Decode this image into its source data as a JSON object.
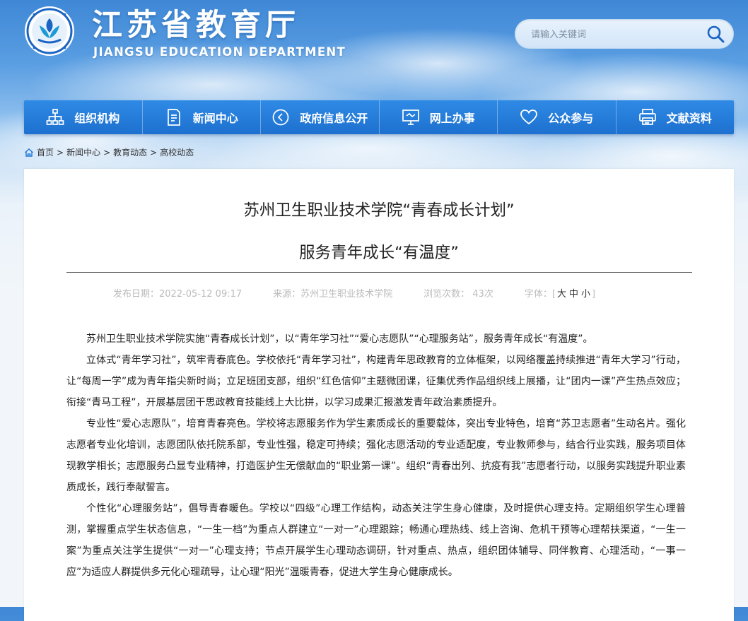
{
  "header": {
    "title": "江苏省教育厅",
    "subtitle": "JIANGSU EDUCATION DEPARTMENT",
    "search_placeholder": "请输入关键词"
  },
  "nav": [
    {
      "label": "组织机构",
      "icon": "org-chart-icon"
    },
    {
      "label": "新闻中心",
      "icon": "document-icon"
    },
    {
      "label": "政府信息公开",
      "icon": "disclosure-icon"
    },
    {
      "label": "网上办事",
      "icon": "monitor-icon"
    },
    {
      "label": "公众参与",
      "icon": "heart-icon"
    },
    {
      "label": "文献资料",
      "icon": "printer-icon"
    }
  ],
  "breadcrumb": [
    "首页",
    "新闻中心",
    "教育动态",
    "高校动态"
  ],
  "article": {
    "title_line1": "苏州卫生职业技术学院“青春成长计划”",
    "title_line2": "服务青年成长“有温度”",
    "meta": {
      "date": "发布日期：2022-05-12 09:17",
      "source": "来源：苏州卫生职业技术学院",
      "views": "浏览次数：  43次",
      "font_label": "字体：",
      "font_large": "大",
      "font_medium": "中",
      "font_small": "小"
    },
    "paragraphs": [
      "苏州卫生职业技术学院实施“青春成长计划”，以“青年学习社”“爱心志愿队”“心理服务站”，服务青年成长“有温度”。",
      "立体式“青年学习社”，筑牢青春底色。学校依托“青年学习社”，构建青年思政教育的立体框架，以网络覆盖持续推进“青年大学习”行动，让“每周一学”成为青年指尖新时尚；立足班团支部，组织“红色信仰”主题微团课，征集优秀作品组织线上展播，让“团内一课”产生热点效应；衔接“青马工程”，开展基层团干思政教育技能线上大比拼，以学习成果汇报激发青年政治素质提升。",
      "专业性“爱心志愿队”，培育青春亮色。学校将志愿服务作为学生素质成长的重要载体，突出专业特色，培育“苏卫志愿者”生动名片。强化志愿者专业化培训，志愿团队依托院系部，专业性强，稳定可持续；强化志愿活动的专业适配度，专业教师参与，结合行业实践，服务项目体现教学相长；志愿服务凸显专业精神，打造医护生无偿献血的“职业第一课”。组织“青春出列、抗疫有我”志愿者行动，以服务实践提升职业素质成长，践行奉献誓言。",
      "个性化“心理服务站”，倡导青春暖色。学校以“四级”心理工作结构，动态关注学生身心健康，及时提供心理支持。定期组织学生心理普测，掌握重点学生状态信息，“一生一档”为重点人群建立“一对一”心理跟踪；畅通心理热线、线上咨询、危机干预等心理帮扶渠道，“一生一案”为重点关注学生提供“一对一”心理支持；节点开展学生心理动态调研，针对重点、热点，组织团体辅导、同伴教育、心理活动，“一事一应”为适应人群提供多元化心理疏导，让心理“阳光”温暖青春，促进大学生身心健康成长。"
    ]
  },
  "colors": {
    "nav_bg": "#1f78d8",
    "header_sky": "#4a90dd"
  }
}
